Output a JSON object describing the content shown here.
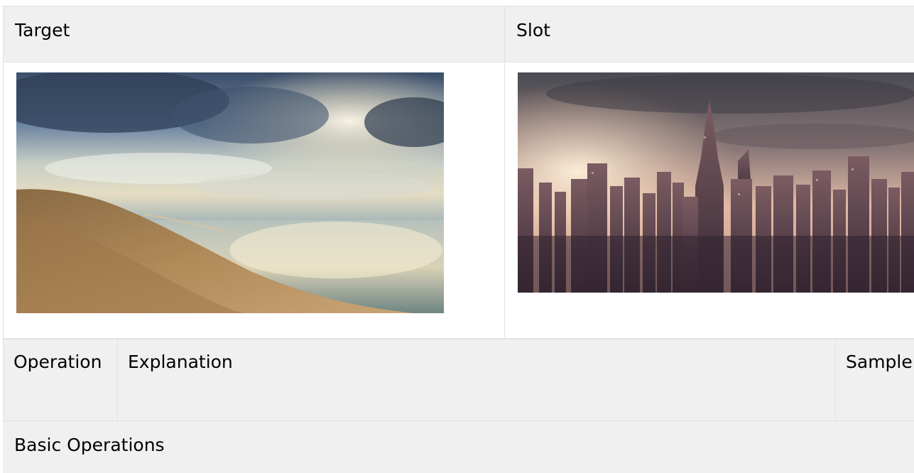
{
  "top_table": {
    "headers": [
      "Target",
      "Slot"
    ],
    "images": [
      {
        "name": "beach-dune-sunset-image",
        "alt": "Sand dune beach with sea and dramatic clouds"
      },
      {
        "name": "city-skyline-sunset-image",
        "alt": "City skyline with skyscrapers at sunset"
      }
    ]
  },
  "ops_table": {
    "headers": [
      "Operation",
      "Explanation",
      "Sample"
    ],
    "section_title": "Basic Operations"
  },
  "colors": {
    "header_bg": "#f0f0f0",
    "border": "#e2e2e2"
  }
}
